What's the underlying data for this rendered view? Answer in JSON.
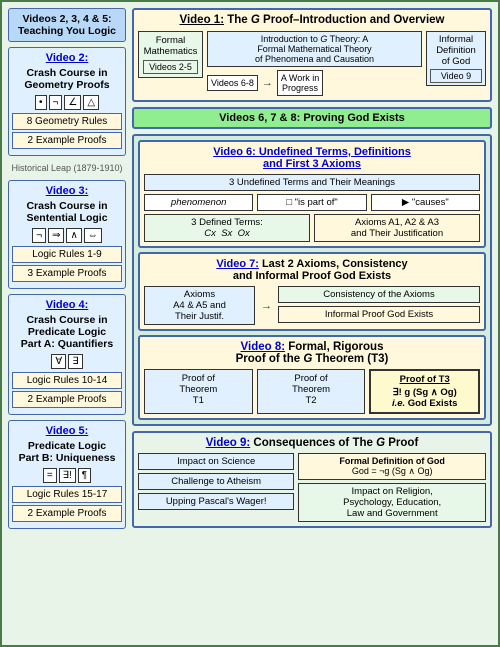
{
  "left": {
    "header": "Videos 2, 3, 4 & 5:\nTeaching You Logic",
    "video2": {
      "title": "Video 2:",
      "subtitle": "Crash Course in\nGeometry Proofs",
      "symbols": [
        "•",
        "¬",
        "∠",
        "△"
      ],
      "detail1": "8 Geometry Rules",
      "detail2": "2 Example Proofs"
    },
    "historical": "Historical Leap  (1879-1910)",
    "video3": {
      "title": "Video 3:",
      "subtitle": "Crash Course in\nSentential Logic",
      "symbols": [
        "¬",
        "⇒",
        "∧",
        "⇔"
      ],
      "detail1": "Logic Rules 1-9",
      "detail2": "3 Example Proofs"
    },
    "video4": {
      "title": "Video 4:",
      "subtitle": "Crash Course in\nPredicate Logic\nPart A: Quantifiers",
      "symbols": [
        "∀",
        "∃"
      ],
      "detail1": "Logic Rules 10-14",
      "detail2": "2 Example Proofs"
    },
    "video5": {
      "title": "Video 5:",
      "subtitle": "Predicate Logic\nPart B: Uniqueness",
      "symbols": [
        "=",
        "∃!",
        "¶"
      ],
      "detail1": "Logic Rules 15-17",
      "detail2": "2 Example Proofs"
    }
  },
  "right": {
    "v1": {
      "title": "Video 1:",
      "rest_title": " The G Proof–Introduction and Overview",
      "formal_math": "Formal\nMathematics",
      "videos25": "Videos 2-5",
      "intro_text": "Introduction to G Theory: A\nFormal Mathematical Theory\nof Phenomena and Causation",
      "videos68": "Videos 6-8",
      "work_in": "A Work in\nProgress",
      "informal": "Informal\nDefinition\nof God",
      "video9": "Video 9"
    },
    "section678_header": "Videos 6, 7 & 8: Proving God Exists",
    "v6": {
      "title": "Video 6: Undefined Terms, Definitions\nand First 3 Axioms",
      "undef_header": "3 Undefined Terms and Their Meanings",
      "term1": "phenomenon",
      "term2": "□ \"is part of\"",
      "term3": "▶ \"causes\"",
      "defined_header": "3 Defined Terms:\nCx   Sx   Ox",
      "axioms_header": "Axioms A1, A2 & A3\nand Their Justification"
    },
    "v7": {
      "title_pre": "Video 7:",
      "title_rest": " Last 2 Axioms, Consistency\nand Informal Proof God Exists",
      "axioms": "Axioms\nA4 & A5 and\nTheir Justif.",
      "consistency": "Consistency of the Axioms",
      "informal": "Informal Proof God Exists"
    },
    "v8": {
      "title_pre": "Video 8:",
      "title_rest": " Formal, Rigorous\nProof of the G Theorem (T3)",
      "proof_t1": "Proof of\nTheorem\nT1",
      "proof_t2": "Proof of\nTheorem\nT2",
      "proof_t3_title": "Proof of T3",
      "proof_t3_content": "∃! g (Sg ∧ Og)\ni.e. God Exists"
    },
    "v9": {
      "title": "Video 9:",
      "title_rest": " Consequences of The G Proof",
      "impact_science": "Impact on Science",
      "challenge": "Challenge to Atheism",
      "upping": "Upping Pascal's Wager!",
      "formal_def": "Formal Definition of God",
      "formal_eq": "God = ¬g (Sg ∧ Og)",
      "impact_rel": "Impact on Religion,\nPsychology, Education,\nLaw and Government"
    }
  }
}
